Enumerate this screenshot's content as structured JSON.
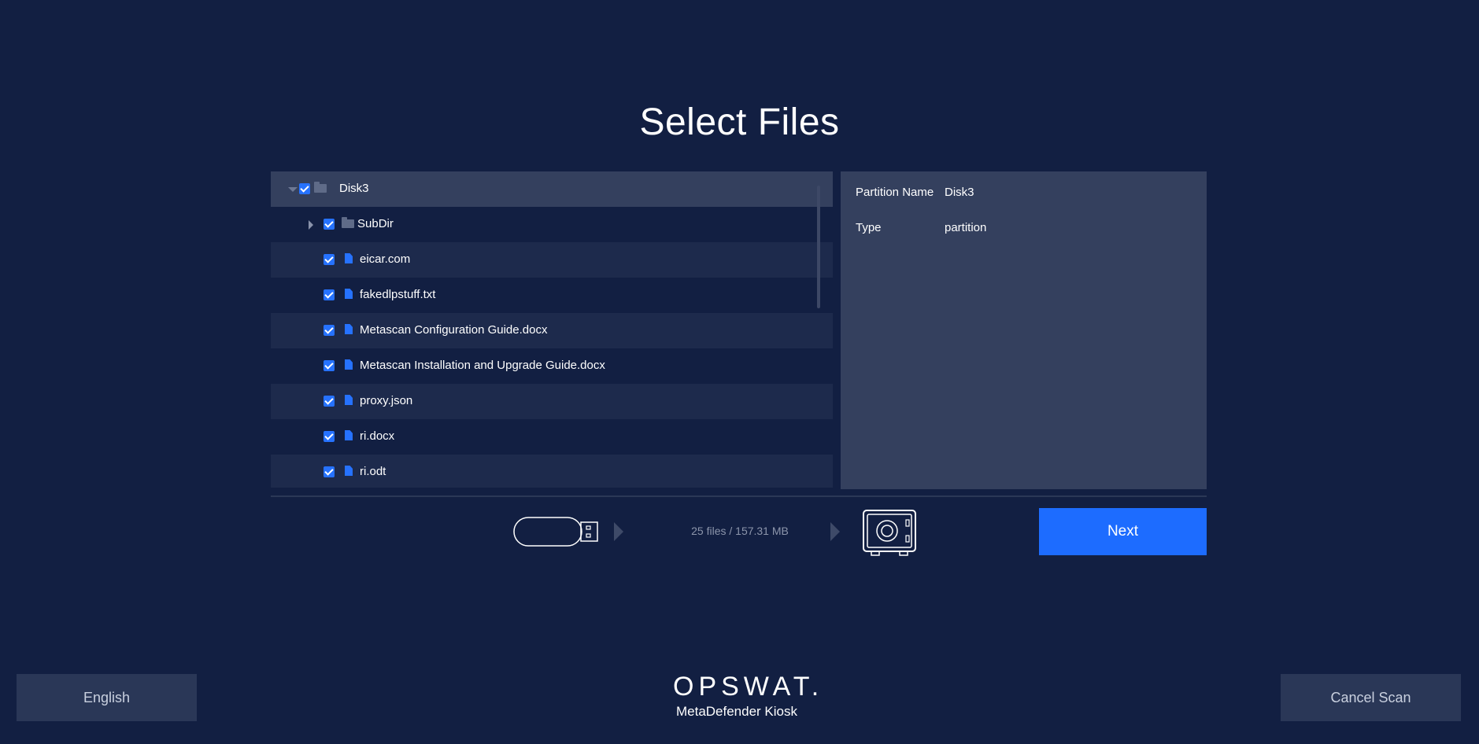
{
  "title": "Select Files",
  "tree": {
    "rows": [
      {
        "label": "Disk3",
        "type": "folder",
        "expanded": true,
        "checked": true
      },
      {
        "label": "SubDir",
        "type": "folder",
        "expanded": false,
        "checked": true
      },
      {
        "label": "eicar.com",
        "type": "file",
        "checked": true
      },
      {
        "label": "fakedlpstuff.txt",
        "type": "file",
        "checked": true
      },
      {
        "label": "Metascan Configuration Guide.docx",
        "type": "file",
        "checked": true
      },
      {
        "label": "Metascan Installation and Upgrade Guide.docx",
        "type": "file",
        "checked": true
      },
      {
        "label": "proxy.json",
        "type": "file",
        "checked": true
      },
      {
        "label": "ri.docx",
        "type": "file",
        "checked": true
      },
      {
        "label": "ri.odt",
        "type": "file",
        "checked": true
      }
    ]
  },
  "details": {
    "partition_name_label": "Partition Name",
    "partition_name_value": "Disk3",
    "type_label": "Type",
    "type_value": "partition"
  },
  "progress": {
    "summary": "25 files / 157.31 MB"
  },
  "buttons": {
    "next": "Next",
    "language": "English",
    "cancel": "Cancel Scan"
  },
  "branding": {
    "logo": "OPSWAT.",
    "product": "MetaDefender Kiosk"
  },
  "colors": {
    "background": "#121f42",
    "accent": "#1d6cff",
    "panel": "#34405e"
  },
  "icons": [
    "folder-icon",
    "file-icon",
    "usb-drive-icon",
    "arrow-right-icon",
    "vault-icon"
  ]
}
